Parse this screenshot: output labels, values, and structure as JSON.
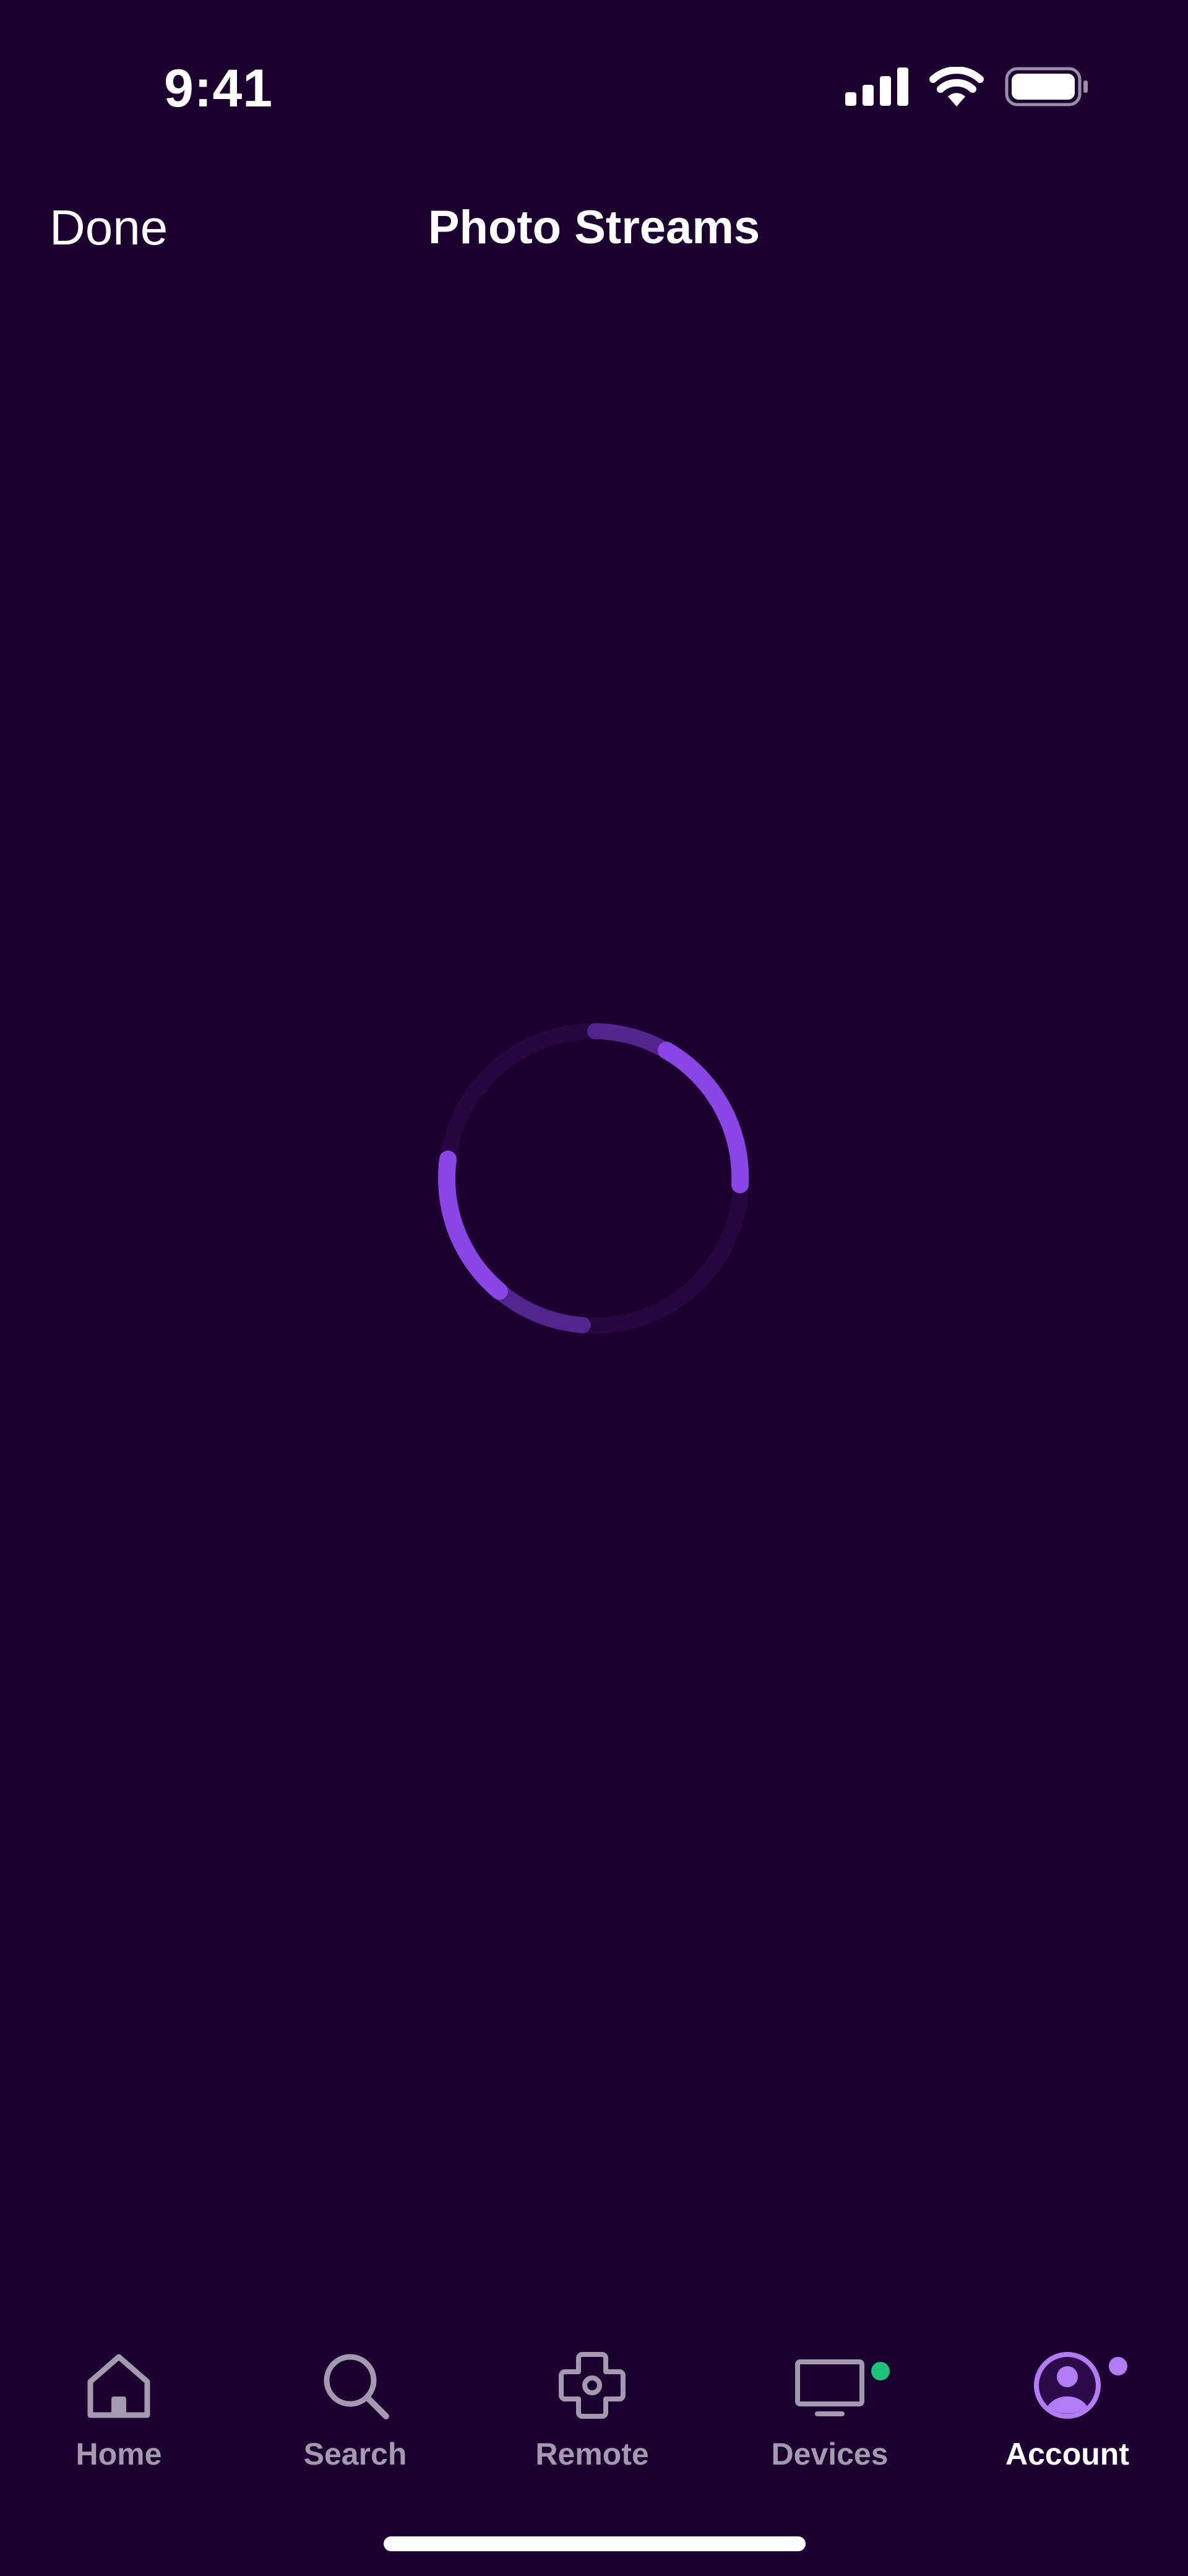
{
  "status_bar": {
    "time": "9:41",
    "icons": [
      "cellular-signal-icon",
      "wifi-icon",
      "battery-icon"
    ]
  },
  "header": {
    "done_label": "Done",
    "title": "Photo Streams"
  },
  "loading": {
    "indicator": "spinner",
    "accent": "#8b45e6"
  },
  "tab_bar": {
    "tabs": [
      {
        "label": "Home",
        "icon": "home-icon",
        "active": false
      },
      {
        "label": "Search",
        "icon": "search-icon",
        "active": false
      },
      {
        "label": "Remote",
        "icon": "remote-dpad-icon",
        "active": false
      },
      {
        "label": "Devices",
        "icon": "tv-icon",
        "active": false,
        "badge_color": "#1ec27a"
      },
      {
        "label": "Account",
        "icon": "account-icon",
        "active": true,
        "badge_color": "#b27cf5"
      }
    ]
  },
  "colors": {
    "background": "#1b0030",
    "inactive_tab": "#a49aaf",
    "active_tab": "#ffffff",
    "accent": "#8b45e6"
  }
}
